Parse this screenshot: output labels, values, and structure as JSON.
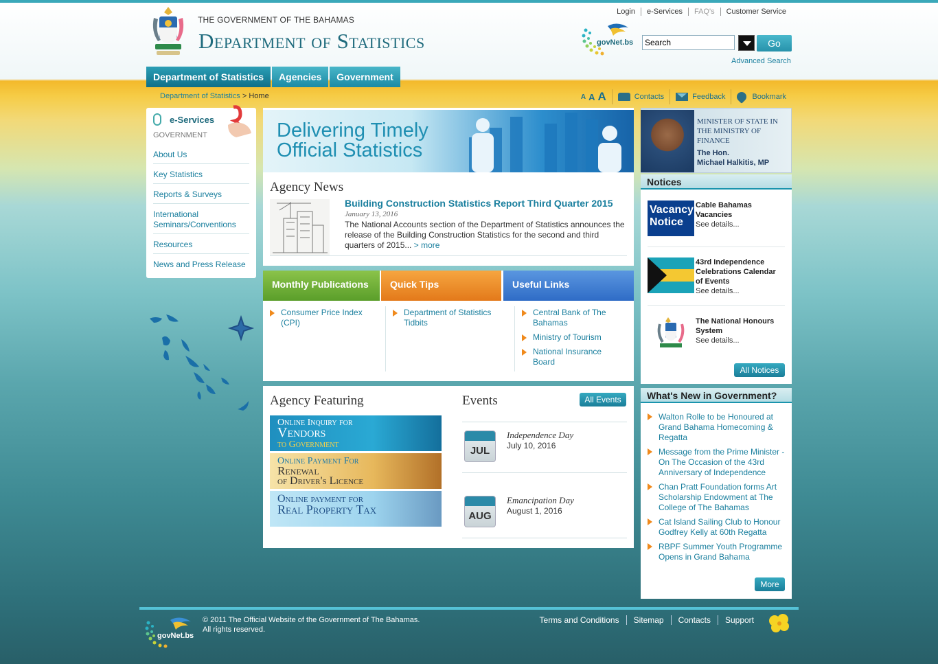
{
  "header": {
    "gov_title": "THE GOVERNMENT OF THE BAHAMAS",
    "dept_title": "Department of Statistics",
    "top_links": [
      "Login",
      "e-Services",
      "FAQ's",
      "Customer Service"
    ],
    "search_value": "Search",
    "go_label": "Go",
    "advanced_search": "Advanced Search",
    "govnet_label": "govNet.bs"
  },
  "nav": {
    "items": [
      "Department of Statistics",
      "Agencies",
      "Government"
    ]
  },
  "breadcrumb": {
    "parent": "Department of Statistics",
    "separator": ">",
    "current": "Home"
  },
  "utilities": {
    "font_sizes": [
      "A",
      "A",
      "A"
    ],
    "contacts": "Contacts",
    "feedback": "Feedback",
    "bookmark": "Bookmark"
  },
  "sidebar": {
    "eservices": "e-Services",
    "group_label": "GOVERNMENT",
    "items": [
      "About Us",
      "Key Statistics",
      "Reports & Surveys",
      "International Seminars/Conventions",
      "Resources",
      "News and Press Release"
    ]
  },
  "banner": {
    "line1": "Delivering Timely",
    "line2": "Official Statistics"
  },
  "news": {
    "heading": "Agency News",
    "title": "Building Construction Statistics Report Third Quarter 2015",
    "date": "January 13, 2016",
    "text": "The National Accounts section of the Department of Statistics announces the release of the Building Construction Statistics for the second and third quarters of 2015...",
    "more": "> more"
  },
  "tabs": {
    "monthly": "Monthly Publications",
    "tips": "Quick Tips",
    "links": "Useful Links",
    "monthly_items": [
      "Consumer Price Index (CPI)"
    ],
    "tips_items": [
      "Department of Statistics Tidbits"
    ],
    "links_items": [
      "Central Bank of The Bahamas",
      "Ministry of Tourism",
      "National Insurance Board"
    ]
  },
  "featuring": {
    "heading": "Agency Featuring",
    "promo1_a": "Online Inquiry for",
    "promo1_b": "Vendors",
    "promo1_c": "to Government",
    "promo2_a": "Online Payment For",
    "promo2_b": "Renewal",
    "promo2_c": "of Driver's Licence",
    "promo3_a": "Online payment for",
    "promo3_b": "Real Property Tax"
  },
  "events": {
    "heading": "Events",
    "all_label": "All Events",
    "items": [
      {
        "month": "JUL",
        "name": "Independence Day",
        "date": "July 10, 2016"
      },
      {
        "month": "AUG",
        "name": "Emancipation Day",
        "date": "August 1, 2016"
      }
    ]
  },
  "minister": {
    "title": "Minister of State in the Ministry of Finance",
    "hon": "The Hon.",
    "name": "Michael Halkitis, MP"
  },
  "notices": {
    "heading": "Notices",
    "see_details": "See details...",
    "all_label": "All Notices",
    "vacancy_image": "Vacancy Notice",
    "items": [
      {
        "title": "Cable Bahamas Vacancies"
      },
      {
        "title": "43rd Independence Celebrations Calendar of Events"
      },
      {
        "title": "The National Honours System"
      }
    ]
  },
  "whats_new": {
    "heading": "What's New in Government?",
    "more_label": "More",
    "items": [
      "Walton Rolle to be Honoured at Grand Bahama Homecoming & Regatta",
      "Message from the Prime Minister - On The Occasion of the 43rd Anniversary of Independence",
      "Chan Pratt Foundation forms Art Scholarship Endowment at The College of The Bahamas",
      "Cat Island Sailing Club to Honour Godfrey Kelly at 60th Regatta",
      "RBPF Summer Youth Programme Opens in Grand Bahama"
    ]
  },
  "footer": {
    "copyright": "© 2011 The Official Website of the Government of The Bahamas.",
    "rights": "All rights reserved.",
    "links": [
      "Terms and Conditions",
      "Sitemap",
      "Contacts",
      "Support"
    ]
  },
  "colors": {
    "accent": "#1a7f9e",
    "nav": "#1c8aa4",
    "bullet": "#f08a1c",
    "band": "#f3b92b"
  }
}
